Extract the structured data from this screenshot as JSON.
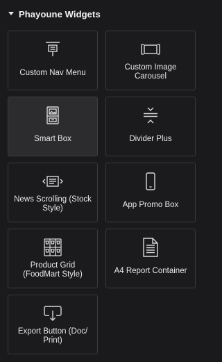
{
  "category": {
    "title": "Phayoune Widgets"
  },
  "widgets": [
    {
      "label": "Custom Nav Menu",
      "icon": "nav-menu-icon"
    },
    {
      "label": "Custom Image Carousel",
      "icon": "image-carousel-icon"
    },
    {
      "label": "Smart Box",
      "icon": "smart-box-icon"
    },
    {
      "label": "Divider Plus",
      "icon": "divider-icon"
    },
    {
      "label": "News Scrolling (Stock Style)",
      "icon": "news-ticker-icon"
    },
    {
      "label": "App Promo Box",
      "icon": "mobile-icon"
    },
    {
      "label": "Product Grid (FoodMart Style)",
      "icon": "product-grid-icon"
    },
    {
      "label": "A4 Report Container",
      "icon": "document-icon"
    },
    {
      "label": "Export Button (Doc/ Print)",
      "icon": "export-icon"
    }
  ],
  "colors": {
    "background": "#1a1a1c",
    "card_border": "#3a3a3d",
    "card_hover": "#2c2c2f",
    "text": "#e8e8e8"
  }
}
